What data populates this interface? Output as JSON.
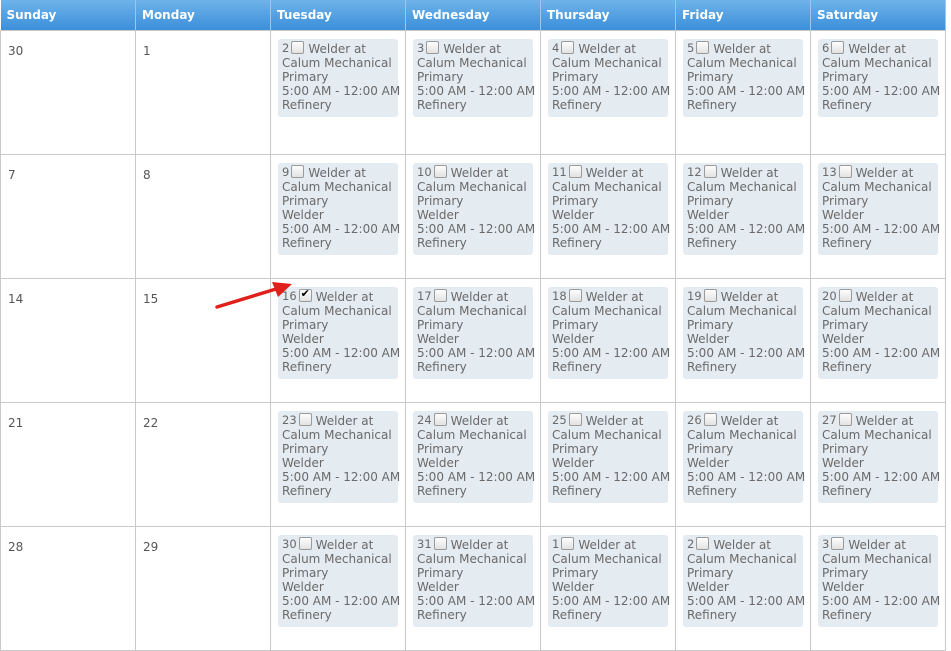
{
  "headers": [
    "Sunday",
    "Monday",
    "Tuesday",
    "Wednesday",
    "Thursday",
    "Friday",
    "Saturday"
  ],
  "weeks": [
    {
      "sunday": "30",
      "monday": "1",
      "shifts": [
        {
          "day": "2",
          "checked": false,
          "lines": [
            "Welder at",
            "Calum Mechanical",
            "Primary",
            "5:00 AM - 12:00 AM",
            "Refinery"
          ]
        },
        {
          "day": "3",
          "checked": false,
          "lines": [
            "Welder at",
            "Calum Mechanical",
            "Primary",
            "5:00 AM - 12:00 AM",
            "Refinery"
          ]
        },
        {
          "day": "4",
          "checked": false,
          "lines": [
            "Welder at",
            "Calum Mechanical",
            "Primary",
            "5:00 AM - 12:00 AM",
            "Refinery"
          ]
        },
        {
          "day": "5",
          "checked": false,
          "lines": [
            "Welder at",
            "Calum Mechanical",
            "Primary",
            "5:00 AM - 12:00 AM",
            "Refinery"
          ]
        },
        {
          "day": "6",
          "checked": false,
          "lines": [
            "Welder at",
            "Calum Mechanical",
            "Primary",
            "5:00 AM - 12:00 AM",
            "Refinery"
          ]
        }
      ]
    },
    {
      "sunday": "7",
      "monday": "8",
      "shifts": [
        {
          "day": "9",
          "checked": false,
          "lines": [
            "Welder at",
            "Calum Mechanical",
            "Primary",
            "Welder",
            "5:00 AM - 12:00 AM",
            "Refinery"
          ]
        },
        {
          "day": "10",
          "checked": false,
          "lines": [
            "Welder at",
            "Calum Mechanical",
            "Primary",
            "Welder",
            "5:00 AM - 12:00 AM",
            "Refinery"
          ]
        },
        {
          "day": "11",
          "checked": false,
          "lines": [
            "Welder at",
            "Calum Mechanical",
            "Primary",
            "Welder",
            "5:00 AM - 12:00 AM",
            "Refinery"
          ]
        },
        {
          "day": "12",
          "checked": false,
          "lines": [
            "Welder at",
            "Calum Mechanical",
            "Primary",
            "Welder",
            "5:00 AM - 12:00 AM",
            "Refinery"
          ]
        },
        {
          "day": "13",
          "checked": false,
          "lines": [
            "Welder at",
            "Calum Mechanical",
            "Primary",
            "Welder",
            "5:00 AM - 12:00 AM",
            "Refinery"
          ]
        }
      ]
    },
    {
      "sunday": "14",
      "monday": "15",
      "shifts": [
        {
          "day": "16",
          "checked": true,
          "lines": [
            "Welder at",
            "Calum Mechanical",
            "Primary",
            "Welder",
            "5:00 AM - 12:00 AM",
            "Refinery"
          ]
        },
        {
          "day": "17",
          "checked": false,
          "lines": [
            "Welder at",
            "Calum Mechanical",
            "Primary",
            "Welder",
            "5:00 AM - 12:00 AM",
            "Refinery"
          ]
        },
        {
          "day": "18",
          "checked": false,
          "lines": [
            "Welder at",
            "Calum Mechanical",
            "Primary",
            "Welder",
            "5:00 AM - 12:00 AM",
            "Refinery"
          ]
        },
        {
          "day": "19",
          "checked": false,
          "lines": [
            "Welder at",
            "Calum Mechanical",
            "Primary",
            "Welder",
            "5:00 AM - 12:00 AM",
            "Refinery"
          ]
        },
        {
          "day": "20",
          "checked": false,
          "lines": [
            "Welder at",
            "Calum Mechanical",
            "Primary",
            "Welder",
            "5:00 AM - 12:00 AM",
            "Refinery"
          ]
        }
      ]
    },
    {
      "sunday": "21",
      "monday": "22",
      "shifts": [
        {
          "day": "23",
          "checked": false,
          "lines": [
            "Welder at",
            "Calum Mechanical",
            "Primary",
            "Welder",
            "5:00 AM - 12:00 AM",
            "Refinery"
          ]
        },
        {
          "day": "24",
          "checked": false,
          "lines": [
            "Welder at",
            "Calum Mechanical",
            "Primary",
            "Welder",
            "5:00 AM - 12:00 AM",
            "Refinery"
          ]
        },
        {
          "day": "25",
          "checked": false,
          "lines": [
            "Welder at",
            "Calum Mechanical",
            "Primary",
            "Welder",
            "5:00 AM - 12:00 AM",
            "Refinery"
          ]
        },
        {
          "day": "26",
          "checked": false,
          "lines": [
            "Welder at",
            "Calum Mechanical",
            "Primary",
            "Welder",
            "5:00 AM - 12:00 AM",
            "Refinery"
          ]
        },
        {
          "day": "27",
          "checked": false,
          "lines": [
            "Welder at",
            "Calum Mechanical",
            "Primary",
            "Welder",
            "5:00 AM - 12:00 AM",
            "Refinery"
          ]
        }
      ]
    },
    {
      "sunday": "28",
      "monday": "29",
      "shifts": [
        {
          "day": "30",
          "checked": false,
          "lines": [
            "Welder at",
            "Calum Mechanical",
            "Primary",
            "Welder",
            "5:00 AM - 12:00 AM",
            "Refinery"
          ]
        },
        {
          "day": "31",
          "checked": false,
          "lines": [
            "Welder at",
            "Calum Mechanical",
            "Primary",
            "Welder",
            "5:00 AM - 12:00 AM",
            "Refinery"
          ]
        },
        {
          "day": "1",
          "checked": false,
          "lines": [
            "Welder at",
            "Calum Mechanical",
            "Primary",
            "Welder",
            "5:00 AM - 12:00 AM",
            "Refinery"
          ]
        },
        {
          "day": "2",
          "checked": false,
          "lines": [
            "Welder at",
            "Calum Mechanical",
            "Primary",
            "Welder",
            "5:00 AM - 12:00 AM",
            "Refinery"
          ]
        },
        {
          "day": "3",
          "checked": false,
          "lines": [
            "Welder at",
            "Calum Mechanical",
            "Primary",
            "Welder",
            "5:00 AM - 12:00 AM",
            "Refinery"
          ]
        }
      ]
    }
  ],
  "colors": {
    "header_top": "#6fb3ea",
    "header_bottom": "#3b8fda",
    "shift_bg": "#e4ebf1",
    "arrow": "#e0201b"
  },
  "annotation": {
    "arrow_icon": "red-arrow-icon",
    "points_to": "checkbox on 16"
  }
}
